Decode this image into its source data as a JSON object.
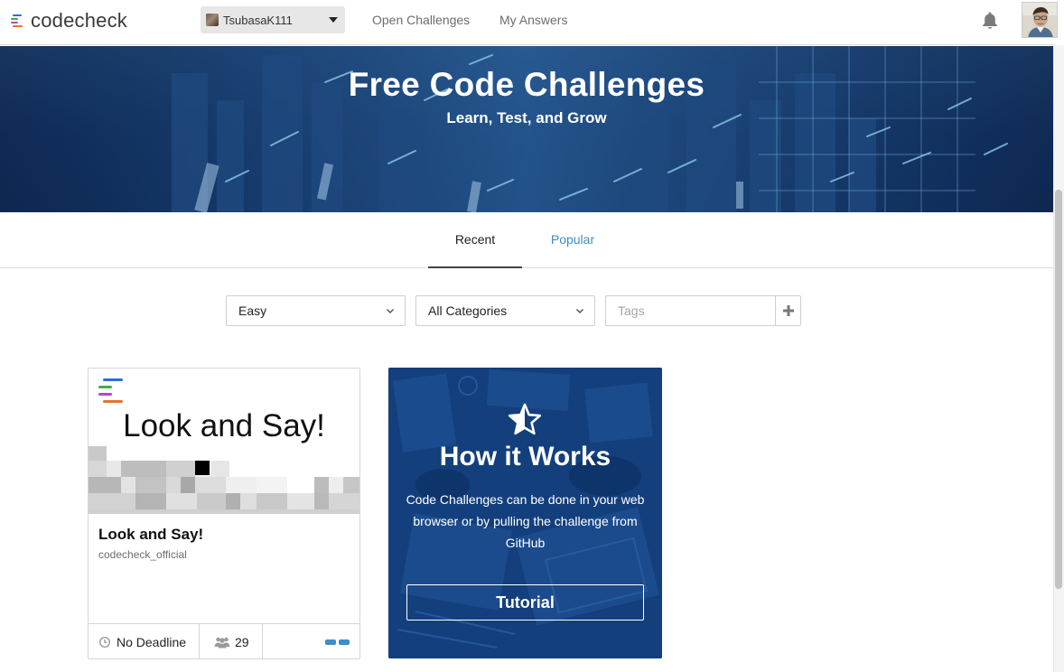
{
  "header": {
    "logo_text": "codecheck",
    "user": {
      "name": "TsubasaK111"
    },
    "nav": [
      {
        "label": "Open Challenges"
      },
      {
        "label": "My Answers"
      }
    ],
    "icons": {
      "notifications": "bell-icon",
      "avatar": "user-avatar"
    }
  },
  "hero": {
    "title": "Free Code Challenges",
    "subtitle": "Learn, Test, and Grow"
  },
  "tabs": [
    {
      "label": "Recent",
      "active": true
    },
    {
      "label": "Popular",
      "active": false
    }
  ],
  "filters": {
    "difficulty": {
      "selected": "Easy"
    },
    "category": {
      "selected": "All Categories"
    },
    "tags": {
      "placeholder": "Tags",
      "value": ""
    }
  },
  "challenges": [
    {
      "thumbnail_title": "Look and Say!",
      "title": "Look and Say!",
      "author": "codecheck_official",
      "deadline": "No Deadline",
      "participants": "29"
    }
  ],
  "how_it_works": {
    "title": "How it Works",
    "description": "Code Challenges can be done in your web browser or by pulling the challenge from GitHub",
    "button_label": "Tutorial"
  },
  "colors": {
    "brand_blue": "#3d8dc8",
    "hero_bg": "#0f2a55",
    "how_bg": "#123c78",
    "logo_bars": [
      "#2a6fd6",
      "#3bb04a",
      "#b048c8",
      "#e8732c"
    ]
  }
}
